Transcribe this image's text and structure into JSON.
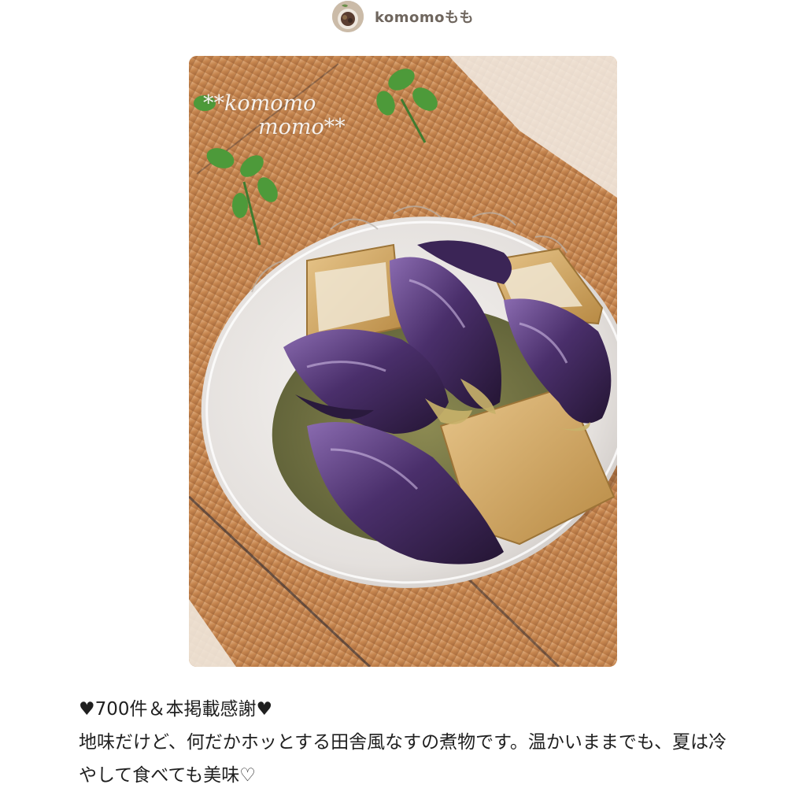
{
  "author": {
    "name": "komomoもも",
    "avatar_icon": "food-photo-avatar"
  },
  "photo": {
    "watermark_line1": "**komomo",
    "watermark_line2": "momo**",
    "subject_icon": "simmered-eggplant-dish-photo"
  },
  "description": {
    "headline": "♥700件＆本掲載感謝♥",
    "body": "地味だけど、何だかホッとする田舎風なすの煮物です。温かいままでも、夏は冷やして食べても美味♡"
  },
  "colors": {
    "author_text": "#6f665e",
    "body_text": "#1f1f1f",
    "eggplant": "#4a2f6b",
    "fried_tofu": "#d4a860",
    "bamboo_mat": "#c98a52"
  }
}
